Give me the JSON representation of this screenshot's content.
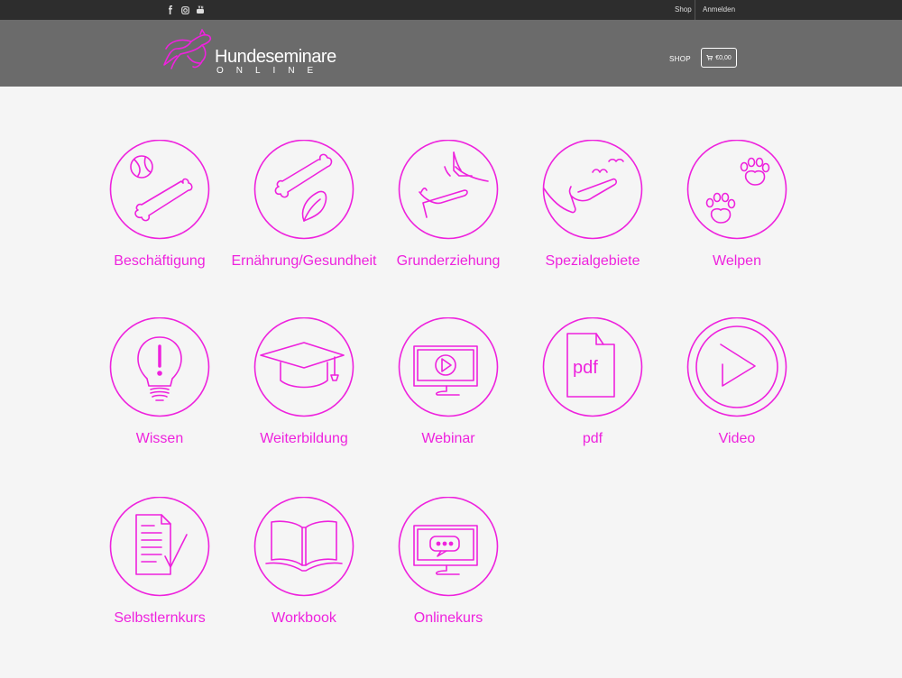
{
  "topbar": {
    "social_icons": [
      "facebook-icon",
      "instagram-icon",
      "youtube-icon"
    ],
    "links": {
      "shop": "Shop",
      "login": "Anmelden"
    }
  },
  "header": {
    "logo": {
      "title": "Hundeseminare",
      "subtitle": "ONLINE"
    },
    "nav": {
      "shop": "SHOP"
    },
    "cart": {
      "icon": "cart-icon",
      "amount": "€0,00"
    }
  },
  "categories": [
    {
      "label": "Beschäftigung",
      "icon": "bone-ball-icon"
    },
    {
      "label": "Ernährung/Gesundheit",
      "icon": "bone-leaf-icon"
    },
    {
      "label": "Grunderziehung",
      "icon": "hand-dog-icon"
    },
    {
      "label": "Spezialgebiete",
      "icon": "dog-birds-icon"
    },
    {
      "label": "Welpen",
      "icon": "paws-icon"
    },
    {
      "label": "Wissen",
      "icon": "lightbulb-icon"
    },
    {
      "label": "Weiterbildung",
      "icon": "graduation-cap-icon"
    },
    {
      "label": "Webinar",
      "icon": "monitor-play-icon"
    },
    {
      "label": "pdf",
      "icon": "pdf-file-icon"
    },
    {
      "label": "Video",
      "icon": "play-icon"
    },
    {
      "label": "Selbstlernkurs",
      "icon": "document-check-icon"
    },
    {
      "label": "Workbook",
      "icon": "open-book-icon"
    },
    {
      "label": "Onlinekurs",
      "icon": "monitor-chat-icon"
    }
  ],
  "colors": {
    "accent": "#ee22dd",
    "topbar": "#2d2d2d",
    "header": "#6b6b6b",
    "background": "#f5f5f5"
  }
}
